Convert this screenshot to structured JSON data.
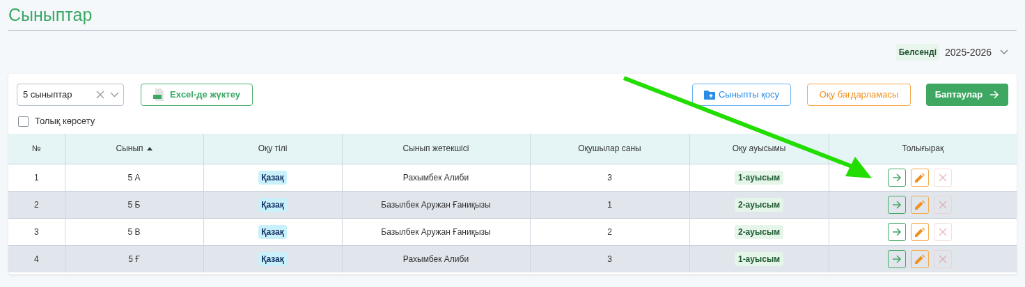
{
  "title": "Сыныптар",
  "year": {
    "badge": "Белсенді",
    "value": "2025-2026"
  },
  "filter": {
    "value": "5 сыныптар"
  },
  "buttons": [
    {
      "kind": "excel",
      "label": "Excel-де жүктеу"
    },
    {
      "kind": "add",
      "label": "Сыныпты қосу"
    },
    {
      "kind": "program",
      "label": "Оқу бағдарламасы"
    },
    {
      "kind": "settings",
      "label": "Баптаулар"
    }
  ],
  "full_view": {
    "label": "Толық көрсету",
    "checked": false
  },
  "table": {
    "columns": [
      {
        "label": "№",
        "sorted": false
      },
      {
        "label": "Сынып",
        "sorted": true
      },
      {
        "label": "Оқу тілі",
        "sorted": false
      },
      {
        "label": "Сынып жетекшісі",
        "sorted": false
      },
      {
        "label": "Оқушылар саны",
        "sorted": false
      },
      {
        "label": "Оқу ауысымы",
        "sorted": false
      },
      {
        "label": "Толығырақ",
        "sorted": false
      }
    ],
    "rows": [
      {
        "no": "1",
        "class": "5 А",
        "language": "Қазақ",
        "teacher": "Рахымбек Алиби",
        "students": "3",
        "shift": "1-ауысым",
        "delete_disabled": true
      },
      {
        "no": "2",
        "class": "5 Б",
        "language": "Қазақ",
        "teacher": "Базылбек Аружан Ғаниқызы",
        "students": "1",
        "shift": "2-ауысым",
        "delete_disabled": true
      },
      {
        "no": "3",
        "class": "5 В",
        "language": "Қазақ",
        "teacher": "Базылбек Аружан Ғаниқызы",
        "students": "2",
        "shift": "2-ауысым",
        "delete_disabled": true
      },
      {
        "no": "4",
        "class": "5 Ғ",
        "language": "Қазақ",
        "teacher": "Рахымбек Алиби",
        "students": "3",
        "shift": "1-ауысым",
        "delete_disabled": true
      }
    ]
  }
}
